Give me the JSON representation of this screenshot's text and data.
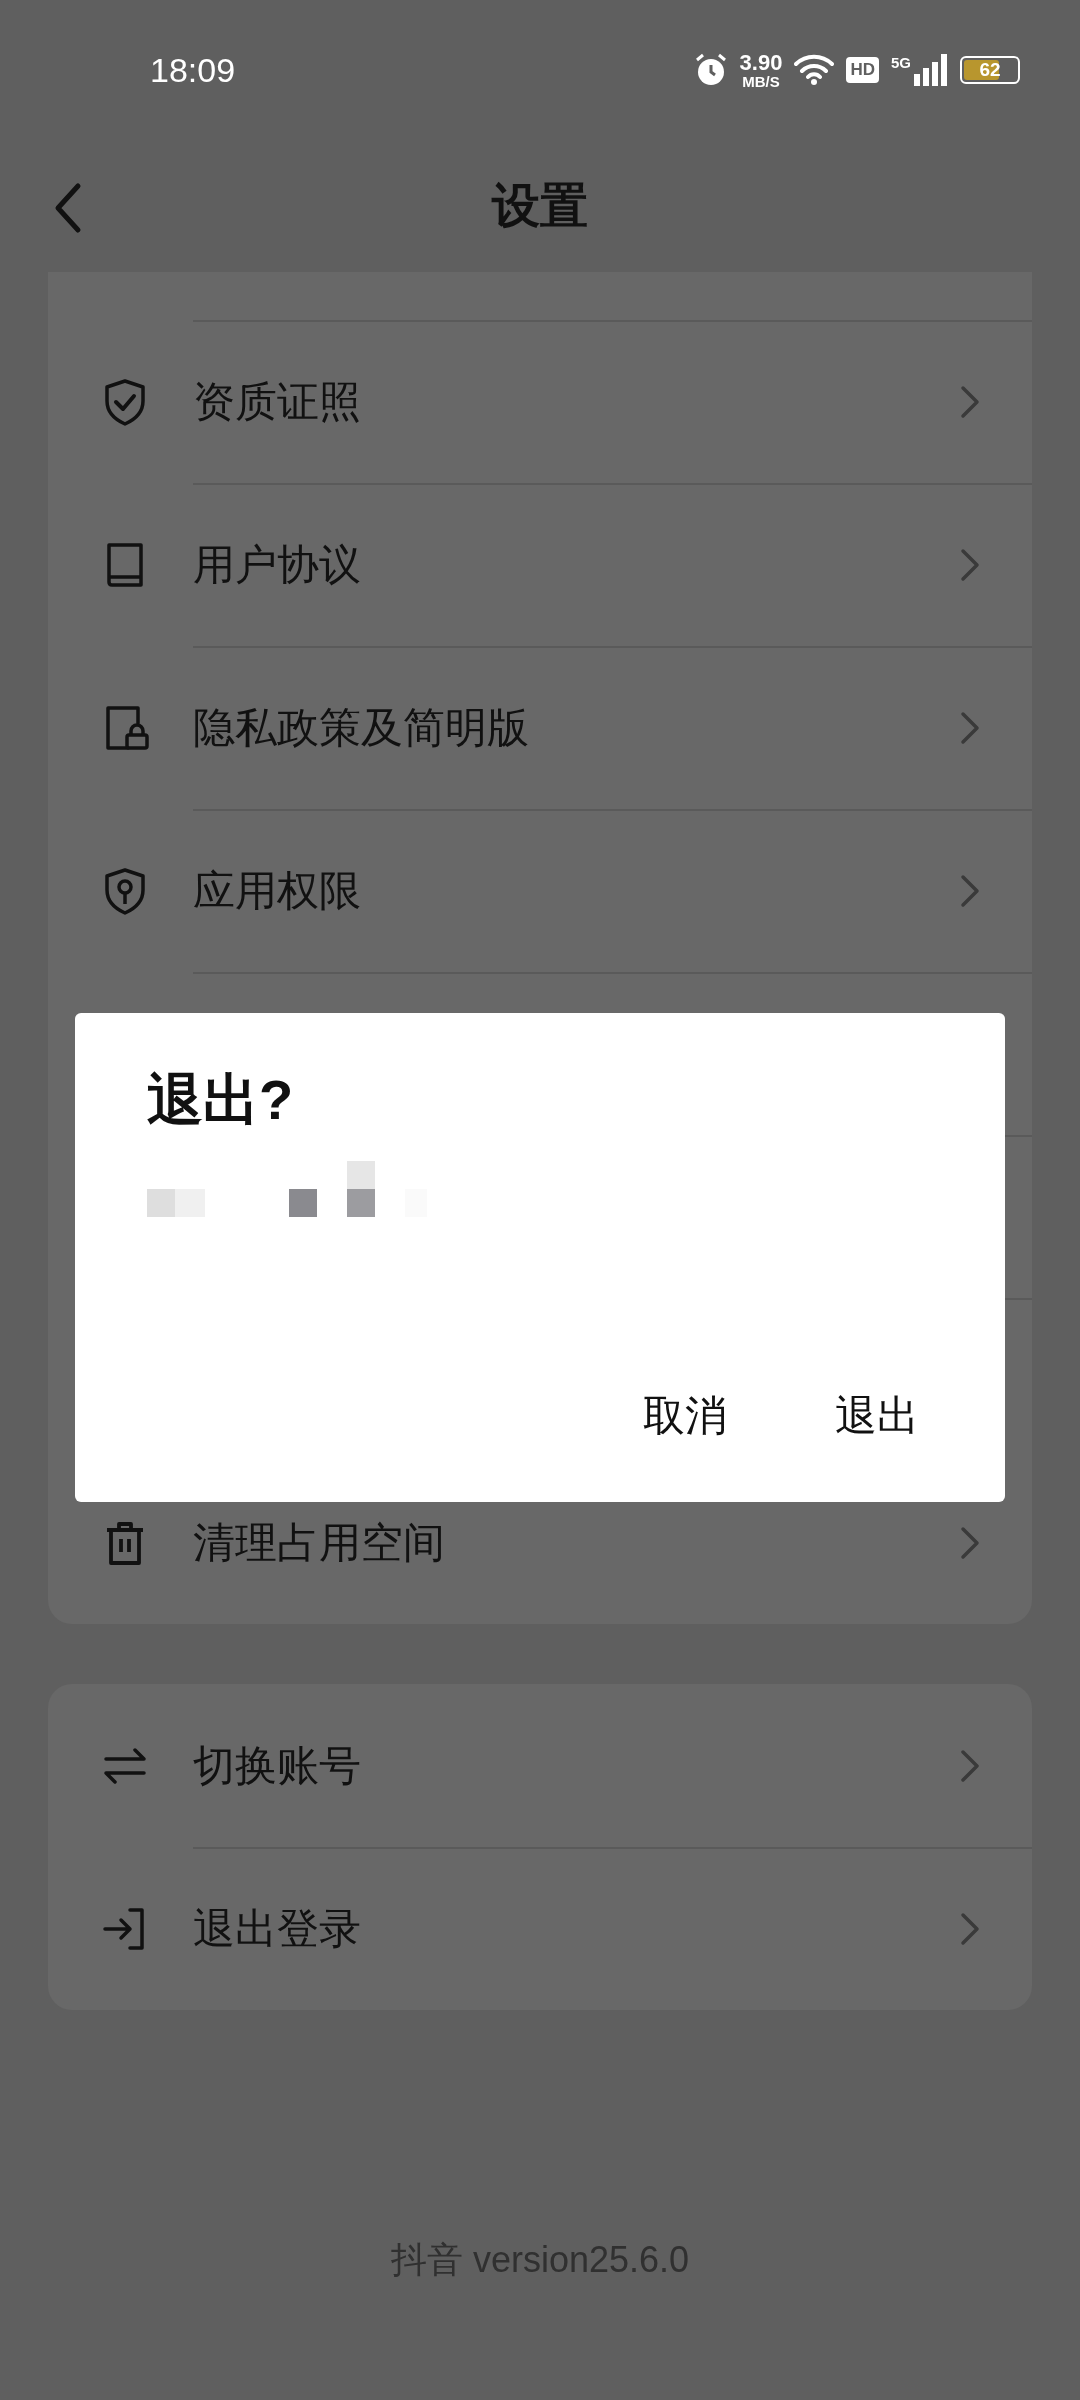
{
  "status_bar": {
    "time": "18:09",
    "net_speed": "3.90",
    "net_speed_unit": "MB/S",
    "hd_badge": "HD",
    "network": "5G",
    "battery": "62"
  },
  "header": {
    "title": "设置"
  },
  "sections": [
    {
      "rows": [
        {
          "kind": "shield-check",
          "label": "资质证照"
        },
        {
          "kind": "book",
          "label": "用户协议"
        },
        {
          "kind": "doc-lock",
          "label": "隐私政策及简明版"
        },
        {
          "kind": "shield-key",
          "label": "应用权限"
        },
        {
          "kind": "trash",
          "label": "清理占用空间"
        }
      ]
    },
    {
      "rows": [
        {
          "kind": "swap",
          "label": "切换账号"
        },
        {
          "kind": "logout",
          "label": "退出登录"
        }
      ]
    }
  ],
  "dialog": {
    "title": "退出?",
    "buttons": [
      "取消",
      "退出"
    ]
  },
  "footer": {
    "version": "抖音 version25.6.0"
  }
}
